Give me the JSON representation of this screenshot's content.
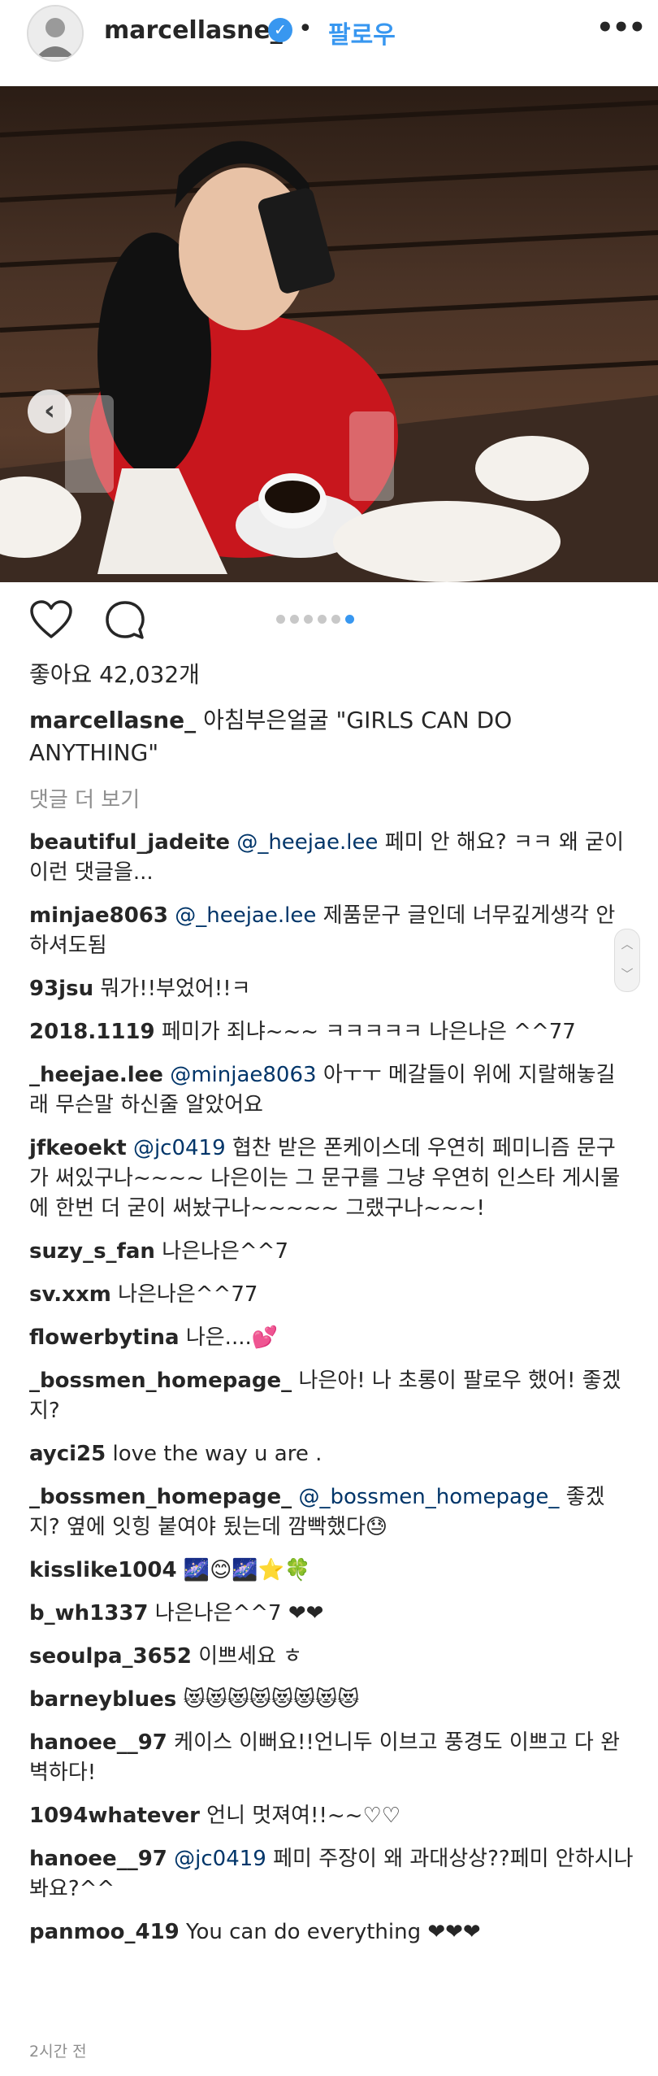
{
  "header": {
    "username": "marcellasne_",
    "verified_icon": "verified-check-icon",
    "separator": "•",
    "follow_label": "팔로우",
    "more_label": "•••"
  },
  "post": {
    "prev_icon": "‹",
    "carousel": {
      "count": 6,
      "active_index": 5
    },
    "likes": "좋아요 42,032개",
    "caption_user": "marcellasne_",
    "caption_text": "아침부은얼굴 \"GIRLS CAN DO ANYTHING\"",
    "view_all": "댓글 더 보기",
    "time": "2시간 전"
  },
  "comments": [
    {
      "user": "beautiful_jadeite",
      "mention": "@_heejae.lee",
      "text": "페미 안 해요? ㅋㅋ 왜 굳이 이런 댓글을..."
    },
    {
      "user": "minjae8063",
      "mention": "@_heejae.lee",
      "text": "제품문구 글인데 너무깊게생각 안하셔도됨"
    },
    {
      "user": "93jsu",
      "mention": "",
      "text": "뭐가!!부었어!!ㅋ"
    },
    {
      "user": "2018.1119",
      "mention": "",
      "text": "페미가 죄냐~~~ ㅋㅋㅋㅋㅋ 나은나은 ^^77"
    },
    {
      "user": "_heejae.lee",
      "mention": "@minjae8063",
      "text": "아ㅜㅜ 메갈들이 위에 지랄해놓길래 무슨말 하신줄 알았어요"
    },
    {
      "user": "jfkeoekt",
      "mention": "@jc0419",
      "text": "협찬 받은 폰케이스데 우연히 페미니즘 문구가 써있구나~~~~ 나은이는 그 문구를 그냥 우연히 인스타 게시물에 한번 더 굳이 써놨구나~~~~~ 그랬구나~~~!"
    },
    {
      "user": "suzy_s_fan",
      "mention": "",
      "text": "나은나은^^7"
    },
    {
      "user": "sv.xxm",
      "mention": "",
      "text": "나은나은^^77"
    },
    {
      "user": "flowerbytina",
      "mention": "",
      "text": "나은....💕"
    },
    {
      "user": "_bossmen_homepage_",
      "mention": "",
      "text": "나은아! 나 초롱이 팔로우 했어! 좋겠지?"
    },
    {
      "user": "ayci25",
      "mention": "",
      "text": "love the way u are ."
    },
    {
      "user": "_bossmen_homepage_",
      "mention": "@_bossmen_homepage_",
      "text": "좋겠지? 옆에 잇힝 붙여야 됬는데 깜빡했다😓"
    },
    {
      "user": "kisslike1004",
      "mention": "",
      "text": "🌌😊🌌⭐🍀"
    },
    {
      "user": "b_wh1337",
      "mention": "",
      "text": "나은나은^^7 ❤❤"
    },
    {
      "user": "seoulpa_3652",
      "mention": "",
      "text": "이쁘세요 ㅎ"
    },
    {
      "user": "barneyblues",
      "mention": "",
      "text": "😻😻😻😻😻😻😻😻"
    },
    {
      "user": "hanoee__97",
      "mention": "",
      "text": "케이스 이뻐요!!언니두 이브고 풍경도 이쁘고 다 완벽하다!"
    },
    {
      "user": "1094whatever",
      "mention": "",
      "text": "언니 멋져여!!~~♡♡"
    },
    {
      "user": "hanoee__97",
      "mention": "@jc0419",
      "text": "페미 주장이 왜 과대상상??페미 안하시나봐요?^^"
    },
    {
      "user": "panmoo_419",
      "mention": "",
      "text": "You can do everything ❤❤❤"
    }
  ],
  "colors": {
    "accent": "#3897f0",
    "mention": "#003569",
    "muted": "#8e8e8e"
  }
}
